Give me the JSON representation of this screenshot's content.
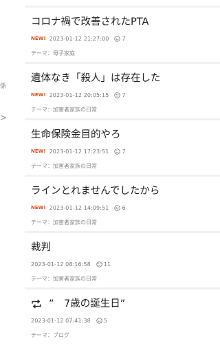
{
  "left_edge": {
    "fragment": "係",
    "chevron": ">"
  },
  "entries": [
    {
      "title": "コロナ禍で改善されたPTA",
      "new_badge": "NEW!",
      "date": "2023-01-12 21:27:00",
      "count": "7",
      "theme": "テーマ：母子家庭"
    },
    {
      "title": "遺体なき「殺人」は存在した",
      "new_badge": "NEW!",
      "date": "2023-01-12 20:05:15",
      "count": "7",
      "theme": "テーマ：加害者家族の日常"
    },
    {
      "title": "生命保険金目的やろ",
      "new_badge": "NEW!",
      "date": "2023-01-12 17:23:51",
      "count": "7",
      "theme": "テーマ：加害者家族の日常"
    },
    {
      "title": "ラインとれませんでしたから",
      "new_badge": "NEW!",
      "date": "2023-01-12 14:09:51",
      "count": "6",
      "theme": "テーマ：加害者家族の日常"
    },
    {
      "title": "裁判",
      "new_badge": "",
      "date": "2023-01-12 08:16:58",
      "count": "11",
      "theme": "テーマ：加害者家族の日常"
    },
    {
      "title": "”　7歳の誕生日”",
      "new_badge": "",
      "date": "2023-01-12 07:41:38",
      "count": "5",
      "theme": "テーマ：ブログ",
      "icon": "reblog-icon"
    }
  ]
}
